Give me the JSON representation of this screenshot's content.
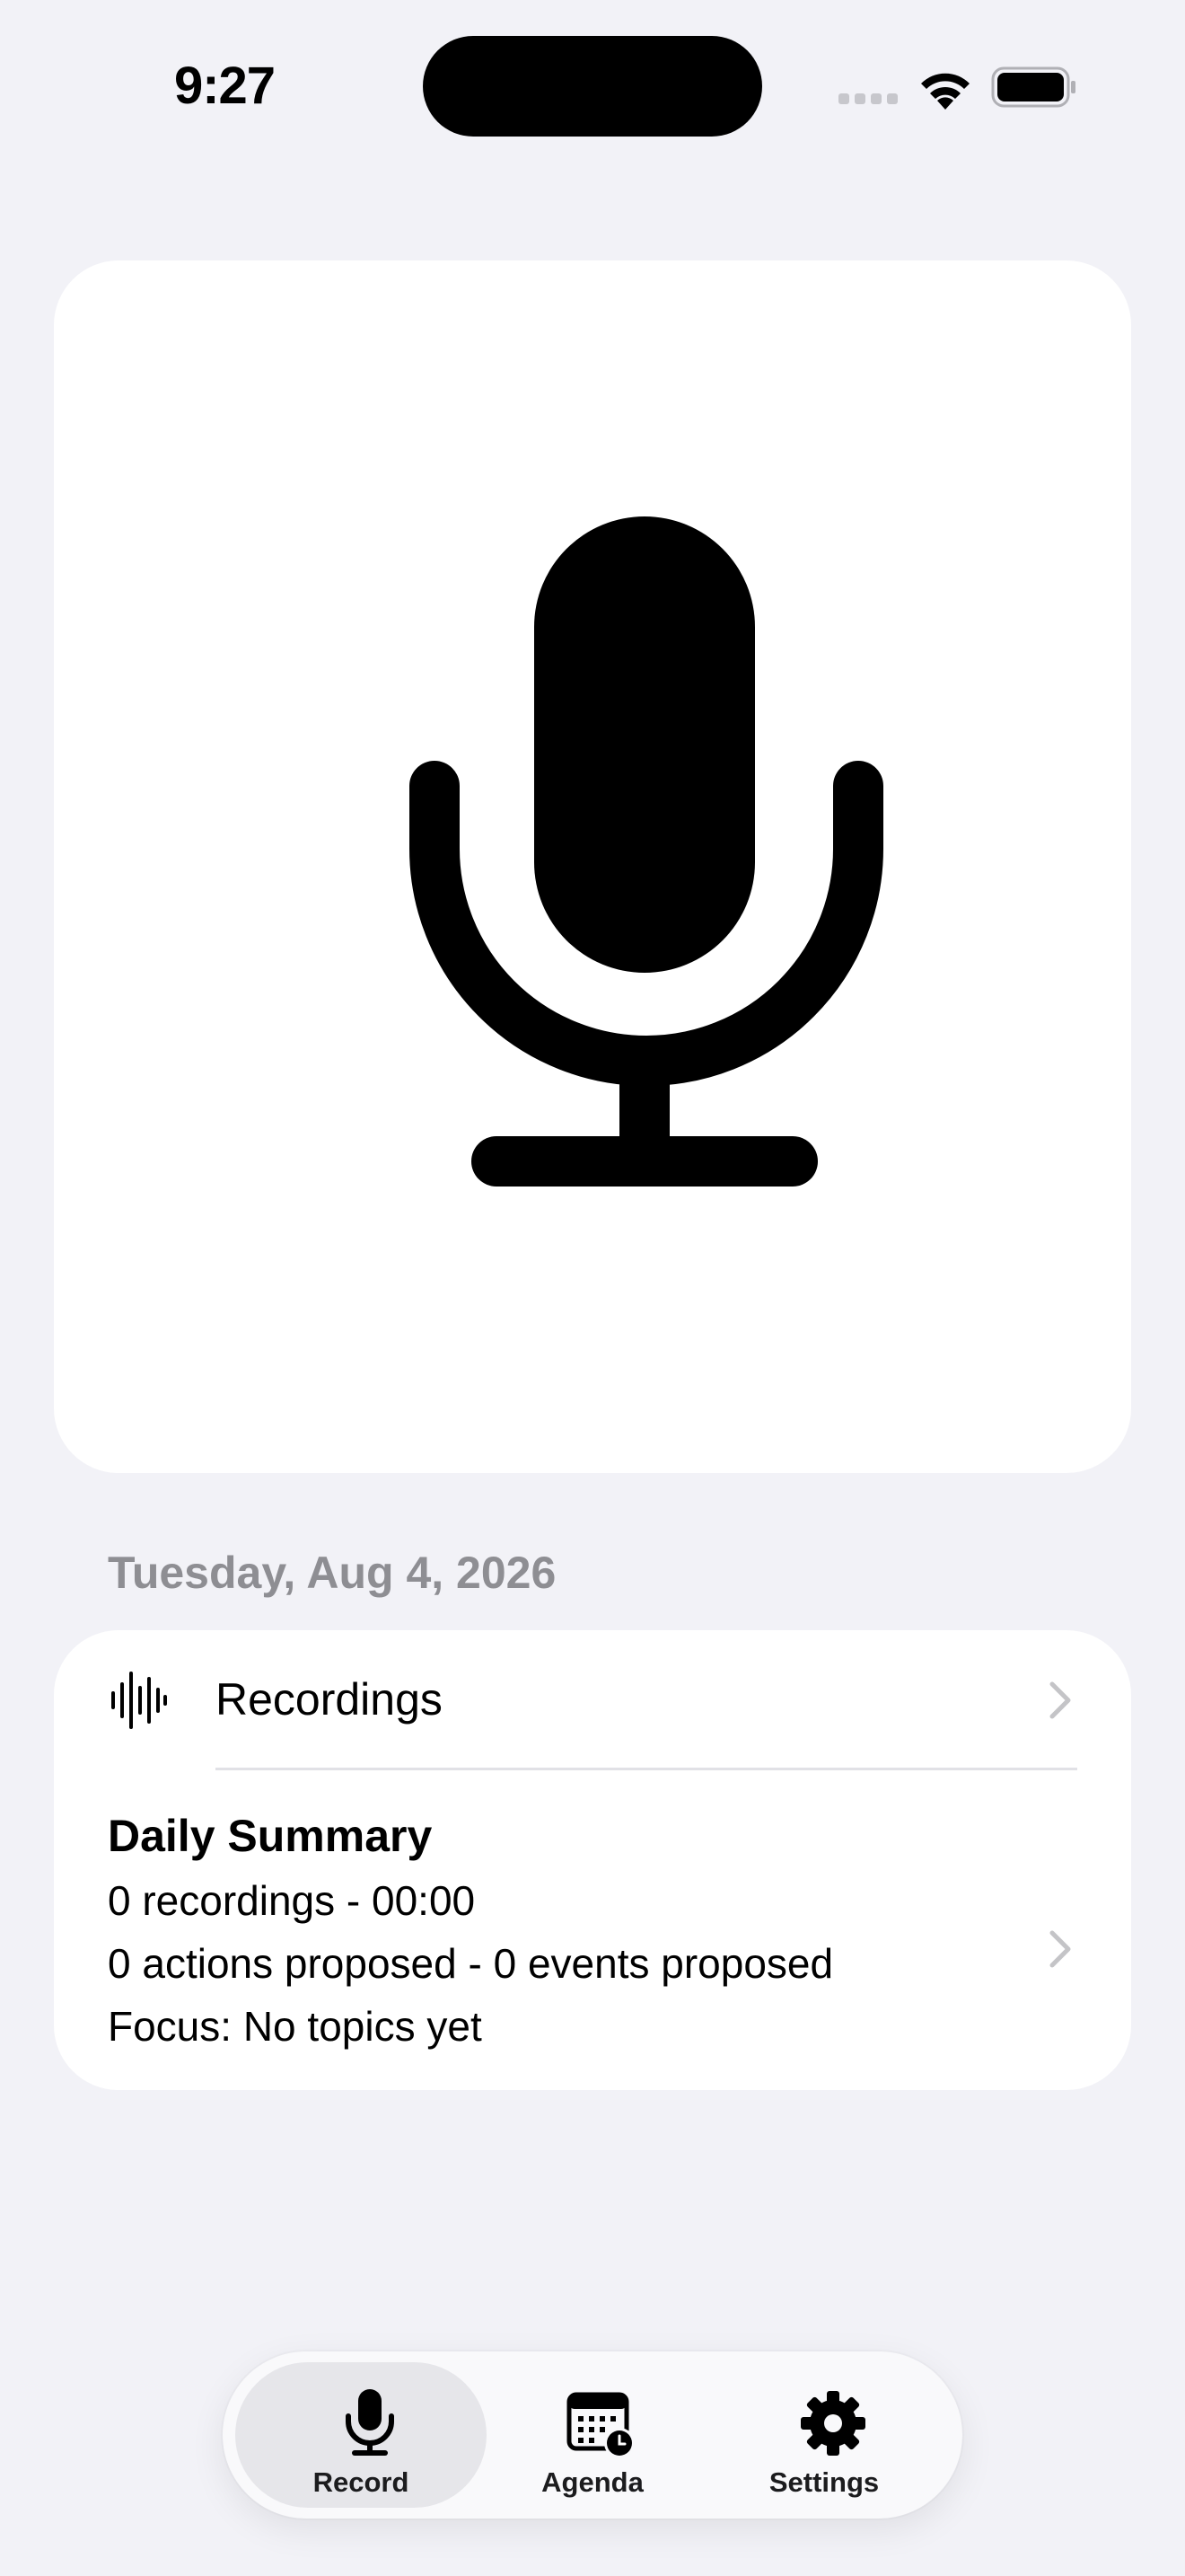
{
  "status_bar": {
    "time": "9:27"
  },
  "mic_card": {
    "icon": "microphone-icon"
  },
  "date_label": "Tuesday, Aug 4, 2026",
  "recordings_row": {
    "icon": "waveform-icon",
    "label": "Recordings"
  },
  "daily_summary": {
    "title": "Daily Summary",
    "line1": "0 recordings - 00:00",
    "line2": "0 actions proposed - 0 events proposed",
    "line3": "Focus: No topics yet"
  },
  "tab_bar": {
    "tabs": [
      {
        "label": "Record",
        "icon": "microphone-icon",
        "active": true
      },
      {
        "label": "Agenda",
        "icon": "calendar-clock-icon",
        "active": false
      },
      {
        "label": "Settings",
        "icon": "gear-icon",
        "active": false
      }
    ]
  },
  "colors": {
    "background": "#f2f2f7",
    "card": "#ffffff",
    "secondary_text": "#8e8e93",
    "chevron": "#c4c4c7"
  }
}
